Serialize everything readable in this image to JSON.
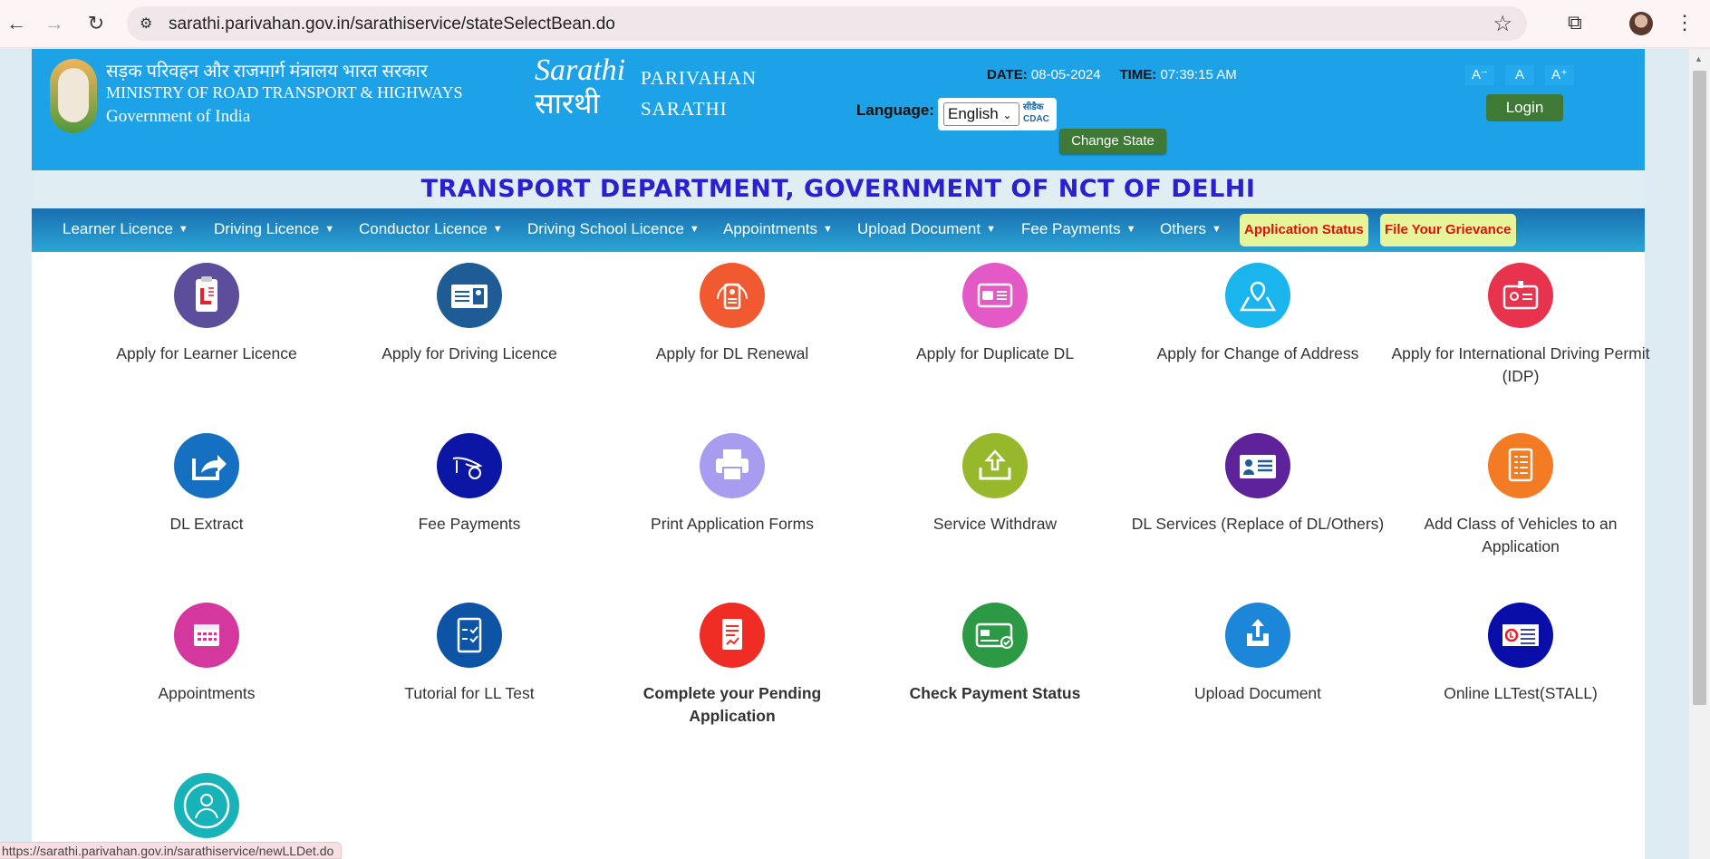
{
  "browser": {
    "url": "sarathi.parivahan.gov.in/sarathiservice/stateSelectBean.do",
    "back_icon": "arrow-left",
    "forward_icon": "arrow-right",
    "reload_icon": "reload",
    "status_url": "https://sarathi.parivahan.gov.in/sarathiservice/newLLDet.do"
  },
  "header": {
    "ministry_hindi": "सड़क परिवहन और राजमार्ग मंत्रालय भारत सरकार",
    "ministry_english": "MINISTRY OF ROAD TRANSPORT & HIGHWAYS",
    "government": "Government of India",
    "logo_text": "Sarathi",
    "logo_text_hindi": "सारथी",
    "parivahan": "PARIVAHAN",
    "sarathi": "SARATHI",
    "date_label": "DATE:",
    "date_value": "08-05-2024",
    "time_label": "TIME:",
    "time_value": "07:39:15 AM",
    "language_label": "Language:",
    "language_selected": "English",
    "cdac_hindi": "सीडैक",
    "cdac": "CDAC",
    "change_state": "Change State",
    "font_decrease": "A⁻",
    "font_normal": "A",
    "font_increase": "A⁺",
    "login": "Login"
  },
  "department_title": "TRANSPORT DEPARTMENT, GOVERNMENT OF NCT OF DELHI",
  "menu": {
    "items": [
      {
        "label": "Learner Licence"
      },
      {
        "label": "Driving Licence"
      },
      {
        "label": "Conductor Licence"
      },
      {
        "label": "Driving School Licence"
      },
      {
        "label": "Appointments"
      },
      {
        "label": "Upload Document"
      },
      {
        "label": "Fee Payments"
      },
      {
        "label": "Others"
      }
    ],
    "application_status": "Application Status",
    "file_grievance": "File Your Grievance"
  },
  "services": [
    {
      "label": "Apply for Learner Licence",
      "icon": "learner-clipboard",
      "color": "#5d4e9c"
    },
    {
      "label": "Apply for Driving Licence",
      "icon": "id-card",
      "color": "#1f5c96"
    },
    {
      "label": "Apply for DL Renewal",
      "icon": "renewal-card",
      "color": "#f15a31"
    },
    {
      "label": "Apply for Duplicate DL",
      "icon": "car-card",
      "color": "#e35ac6"
    },
    {
      "label": "Apply for Change of Address",
      "icon": "map-pin",
      "color": "#1bb5ee"
    },
    {
      "label": "Apply for International Driving Permit (IDP)",
      "icon": "badge-card",
      "color": "#e8334e"
    },
    {
      "label": "DL Extract",
      "icon": "share-arrow",
      "color": "#1570c2"
    },
    {
      "label": "Fee Payments",
      "icon": "hand-rupee",
      "color": "#0b16a4"
    },
    {
      "label": "Print Application Forms",
      "icon": "printer",
      "color": "#a79cf0"
    },
    {
      "label": "Service Withdraw",
      "icon": "upload-tray",
      "color": "#97b82b"
    },
    {
      "label": "DL Services (Replace of DL/Others)",
      "icon": "profile-card",
      "color": "#5e239b"
    },
    {
      "label": "Add Class of Vehicles to an Application",
      "icon": "list-doc",
      "color": "#f27b24"
    },
    {
      "label": "Appointments",
      "icon": "calendar",
      "color": "#d4379d"
    },
    {
      "label": "Tutorial for LL Test",
      "icon": "checklist",
      "color": "#0e54a5"
    },
    {
      "label": "Complete your Pending Application",
      "icon": "pending-doc",
      "color": "#ef2d24",
      "bold": true
    },
    {
      "label": "Check Payment Status",
      "icon": "payment-card",
      "color": "#2c9a45",
      "bold": true
    },
    {
      "label": "Upload Document",
      "icon": "upload-box",
      "color": "#1c86d8"
    },
    {
      "label": "Online LLTest(STALL)",
      "icon": "ll-card",
      "color": "#0a0ea8"
    },
    {
      "label": "",
      "icon": "doctor",
      "color": "#18b3b8"
    }
  ]
}
